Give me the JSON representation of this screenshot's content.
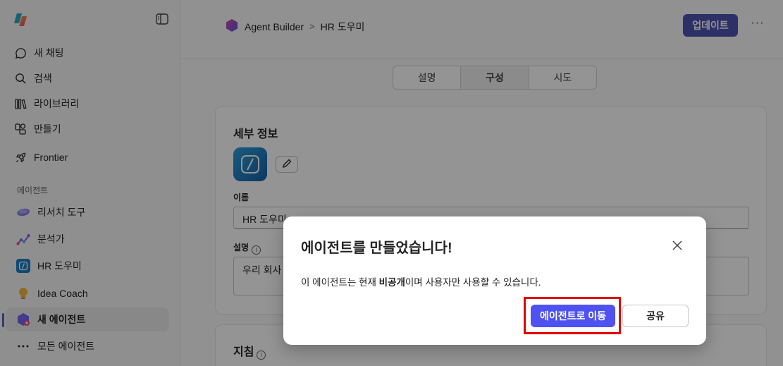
{
  "sidebar": {
    "nav": [
      {
        "label": "새 채팅",
        "icon": "chat-icon"
      },
      {
        "label": "검색",
        "icon": "search-icon"
      },
      {
        "label": "라이브러리",
        "icon": "library-icon"
      },
      {
        "label": "만들기",
        "icon": "create-icon"
      },
      {
        "label": "Frontier",
        "icon": "rocket-icon"
      }
    ],
    "section_label": "에이전트",
    "agents": [
      {
        "label": "리서치 도구",
        "icon": "research-agent-icon"
      },
      {
        "label": "분석가",
        "icon": "analyst-agent-icon"
      },
      {
        "label": "HR 도우미",
        "icon": "hr-agent-icon"
      },
      {
        "label": "Idea Coach",
        "icon": "lightbulb-icon"
      },
      {
        "label": "새 에이전트",
        "icon": "new-agent-icon",
        "active": true
      },
      {
        "label": "모든 에이전트",
        "icon": "more-dots-icon"
      }
    ]
  },
  "header": {
    "breadcrumb_root": "Agent Builder",
    "breadcrumb_separator": ">",
    "breadcrumb_current": "HR 도우미",
    "update_label": "업데이트",
    "more_label": "···"
  },
  "tabs": [
    {
      "label": "설명",
      "active": false
    },
    {
      "label": "구성",
      "active": true
    },
    {
      "label": "시도",
      "active": false
    }
  ],
  "details": {
    "title": "세부 정보",
    "name_label": "이름",
    "name_value": "HR 도우미",
    "description_label": "설명",
    "description_value": "우리 회사"
  },
  "instructions": {
    "title": "지침"
  },
  "modal": {
    "title": "에이전트를 만들었습니다!",
    "body_prefix": "이 에이전트는 현재 ",
    "body_bold": "비공개",
    "body_suffix": "이며 사용자만 사용할 수 있습니다.",
    "primary_label": "에이전트로 이동",
    "secondary_label": "공유"
  },
  "colors": {
    "accent": "#4f52b2",
    "primary_button": "#4f52f0",
    "highlight": "#e00000"
  }
}
